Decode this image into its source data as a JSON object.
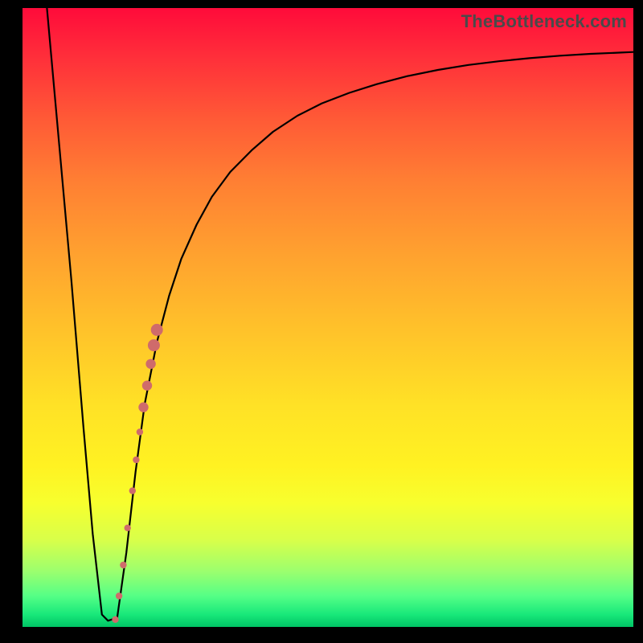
{
  "watermark": "TheBottleneck.com",
  "chart_data": {
    "type": "line",
    "title": "",
    "xlabel": "",
    "ylabel": "",
    "xlim": [
      0,
      100
    ],
    "ylim": [
      0,
      100
    ],
    "series": [
      {
        "name": "curve",
        "x": [
          4,
          6,
          8,
          10,
          11.5,
          13,
          14,
          15.5,
          17,
          18.5,
          20,
          22,
          24,
          26,
          28.5,
          31,
          34,
          37.5,
          41,
          45,
          49,
          53.5,
          58,
          63,
          68,
          73,
          78,
          83,
          88,
          93,
          98,
          100
        ],
        "y": [
          100,
          78,
          56,
          32,
          15,
          2,
          1,
          1.5,
          12,
          25,
          36,
          46,
          53.5,
          59.5,
          65,
          69.5,
          73.5,
          77,
          80,
          82.6,
          84.6,
          86.3,
          87.7,
          89,
          90,
          90.8,
          91.4,
          91.9,
          92.3,
          92.6,
          92.8,
          92.9
        ]
      }
    ],
    "markers": {
      "name": "highlight-points",
      "color": "#cf6b6b",
      "x": [
        15.2,
        15.8,
        16.5,
        17.2,
        18.0,
        18.6,
        19.2,
        19.8,
        20.4,
        21.0,
        21.5,
        22.0
      ],
      "y": [
        1.2,
        5,
        10,
        16,
        22,
        27,
        31.5,
        35.5,
        39,
        42.5,
        45.5,
        48
      ]
    }
  }
}
